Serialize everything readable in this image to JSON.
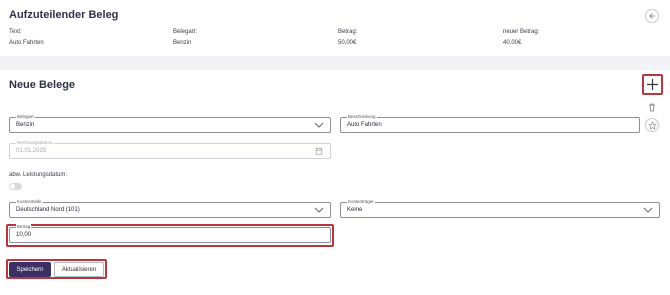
{
  "summary": {
    "title": "Aufzuteilender Beleg",
    "headers": {
      "text": "Text:",
      "belegart": "Belegart:",
      "betrag": "Betrag:",
      "neuer_betrag": "neuer Betrag:"
    },
    "values": {
      "text": "Auto Fahrten",
      "belegart": "Benzin",
      "betrag": "50,00€",
      "neuer_betrag": "40,00€"
    },
    "back_icon": "arrow-left-icon"
  },
  "new_receipts": {
    "title": "Neue Belege",
    "add_icon": "plus-icon",
    "delete_icon": "trash-icon",
    "favorite_icon": "star-icon",
    "belegart": {
      "label": "Belegart",
      "value": "Benzin"
    },
    "beschreibung": {
      "label": "Beschreibung",
      "value": "Auto Fahrten"
    },
    "rechnungsdatum": {
      "label": "Rechnungsdatum",
      "value": "01.01.2025"
    },
    "abw_leistungsdatum": {
      "label": "abw. Leistungsdatum:",
      "enabled": false
    },
    "kostenstelle": {
      "label": "Kostenstelle",
      "value": "Deutschland Nord (101)"
    },
    "kostentraeger": {
      "label": "Kostenträger",
      "value": "Keine"
    },
    "betrag": {
      "label": "Betrag",
      "value": "10,00"
    },
    "buttons": {
      "save": "Speichern",
      "update": "Aktualisieren"
    }
  },
  "colors": {
    "primary": "#3c2f63",
    "highlight": "#b6383e",
    "background": "#f3f3f6"
  }
}
